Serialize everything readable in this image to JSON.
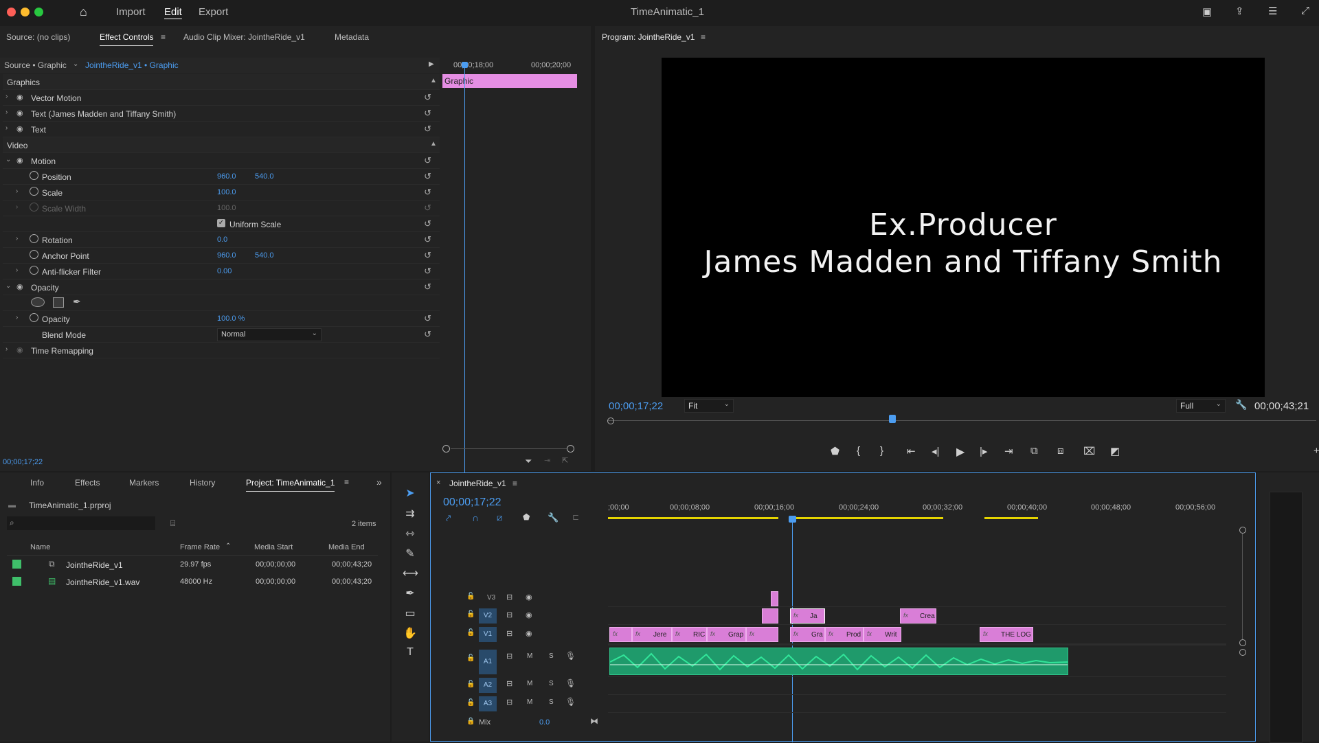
{
  "app": {
    "title": "TimeAnimatic_1",
    "menu": [
      "Import",
      "Edit",
      "Export"
    ],
    "active_menu": "Edit"
  },
  "source_panel": {
    "tabs": [
      "Source: (no clips)",
      "Effect Controls",
      "Audio Clip Mixer: JointheRide_v1",
      "Metadata"
    ],
    "active_tab": "Effect Controls",
    "source_selector": "Source • Graphic",
    "sequence_selector": "JointheRide_v1 • Graphic",
    "timecodes": [
      "00;00;18;00",
      "00;00;20;00"
    ],
    "clip_label": "Graphic",
    "current_time": "00;00;17;22",
    "sections": {
      "graphics": "Graphics",
      "video": "Video"
    },
    "graphics_items": [
      "Vector Motion",
      "Text (James Madden and Tiffany Smith)",
      "Text"
    ],
    "motion": {
      "label": "Motion",
      "position_label": "Position",
      "position_x": "960.0",
      "position_y": "540.0",
      "scale_label": "Scale",
      "scale": "100.0",
      "scale_width_label": "Scale Width",
      "scale_width": "100.0",
      "uniform_scale_label": "Uniform Scale",
      "rotation_label": "Rotation",
      "rotation": "0.0",
      "anchor_label": "Anchor Point",
      "anchor_x": "960.0",
      "anchor_y": "540.0",
      "antiflicker_label": "Anti-flicker Filter",
      "antiflicker": "0.00"
    },
    "opacity": {
      "section_label": "Opacity",
      "label": "Opacity",
      "value": "100.0 %",
      "blend_label": "Blend Mode",
      "blend_value": "Normal"
    },
    "time_remapping": "Time Remapping"
  },
  "program_monitor": {
    "title": "Program: JointheRide_v1",
    "line1": "Ex.Producer",
    "line2": "James Madden and Tiffany Smith",
    "current_time": "00;00;17;22",
    "fit": "Fit",
    "quality": "Full",
    "duration": "00;00;43;21",
    "playhead_progress": 0.402
  },
  "project_panel": {
    "tabs": [
      "Info",
      "Effects",
      "Markers",
      "History",
      "Project: TimeAnimatic_1"
    ],
    "active_tab": "Project: TimeAnimatic_1",
    "file": "TimeAnimatic_1.prproj",
    "item_count": "2 items",
    "columns": [
      "Name",
      "Frame Rate",
      "Media Start",
      "Media End"
    ],
    "rows": [
      {
        "name": "JointheRide_v1",
        "rate": "29.97 fps",
        "start": "00;00;00;00",
        "end": "00;00;43;20",
        "color": "#3fbf6a",
        "icon": "sequence-icon"
      },
      {
        "name": "JointheRide_v1.wav",
        "rate": "48000 Hz",
        "start": "00;00;00;00",
        "end": "00;00;43;20",
        "color": "#3fbf6a",
        "icon": "audio-file-icon"
      }
    ]
  },
  "timeline": {
    "sequence_name": "JointheRide_v1",
    "current_time": "00;00;17;22",
    "ruler": [
      ";00;00",
      "00;00;08;00",
      "00;00;16;00",
      "00;00;24;00",
      "00;00;32;00",
      "00;00;40;00",
      "00;00;48;00",
      "00;00;56;00"
    ],
    "video_tracks": [
      "V3",
      "V2",
      "V1"
    ],
    "audio_tracks": [
      "A1",
      "A2",
      "A3"
    ],
    "mix_label": "Mix",
    "mix_value": "0.0",
    "v1_clips": [
      "Jere",
      "RIC",
      "Grap",
      "Gra",
      "Prod",
      "Writ",
      "THE LOG"
    ],
    "v2_clips": [
      "Ja",
      "Crea"
    ]
  }
}
